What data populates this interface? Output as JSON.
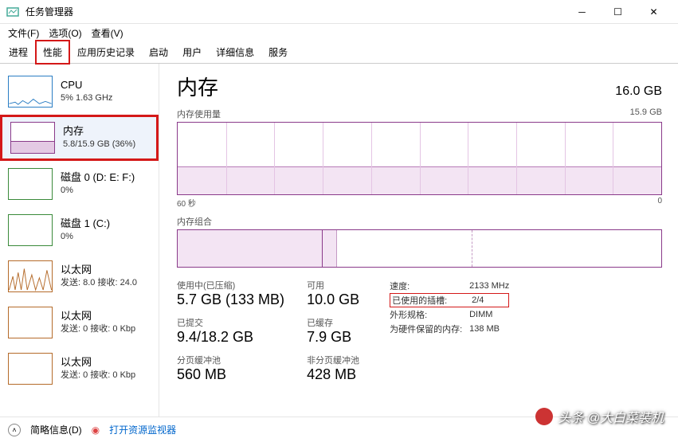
{
  "window": {
    "title": "任务管理器"
  },
  "menu": {
    "file": "文件(F)",
    "options": "选项(O)",
    "view": "查看(V)"
  },
  "tabs": [
    "进程",
    "性能",
    "应用历史记录",
    "启动",
    "用户",
    "详细信息",
    "服务"
  ],
  "activeTab": 1,
  "sidebar": [
    {
      "name": "CPU",
      "sub": "5% 1.63 GHz",
      "type": "cpu"
    },
    {
      "name": "内存",
      "sub": "5.8/15.9 GB (36%)",
      "type": "mem",
      "selected": true
    },
    {
      "name": "磁盘 0 (D: E: F:)",
      "sub": "0%",
      "type": "disk"
    },
    {
      "name": "磁盘 1 (C:)",
      "sub": "0%",
      "type": "disk"
    },
    {
      "name": "以太网",
      "sub": "发送: 8.0 接收: 24.0",
      "type": "net"
    },
    {
      "name": "以太网",
      "sub": "发送: 0 接收: 0 Kbp",
      "type": "net-idle"
    },
    {
      "name": "以太网",
      "sub": "发送: 0 接收: 0 Kbp",
      "type": "net-idle"
    }
  ],
  "header": {
    "title": "内存",
    "total": "16.0 GB"
  },
  "usage": {
    "label": "内存使用量",
    "right": "15.9 GB",
    "axisLeft": "60 秒",
    "axisRight": "0"
  },
  "composition": {
    "label": "内存组合"
  },
  "stats": {
    "inuse": {
      "label": "使用中(已压缩)",
      "value": "5.7 GB (133 MB)"
    },
    "available": {
      "label": "可用",
      "value": "10.0 GB"
    },
    "committed": {
      "label": "已提交",
      "value": "9.4/18.2 GB"
    },
    "cached": {
      "label": "已缓存",
      "value": "7.9 GB"
    },
    "paged": {
      "label": "分页缓冲池",
      "value": "560 MB"
    },
    "nonpaged": {
      "label": "非分页缓冲池",
      "value": "428 MB"
    }
  },
  "info": {
    "speed": {
      "k": "速度:",
      "v": "2133 MHz"
    },
    "slots": {
      "k": "已使用的插槽:",
      "v": "2/4"
    },
    "form": {
      "k": "外形规格:",
      "v": "DIMM"
    },
    "reserved": {
      "k": "为硬件保留的内存:",
      "v": "138 MB"
    }
  },
  "statusbar": {
    "brief": "简略信息(D)",
    "resmon": "打开资源监视器"
  },
  "watermark": "头条 @大白菜装机"
}
